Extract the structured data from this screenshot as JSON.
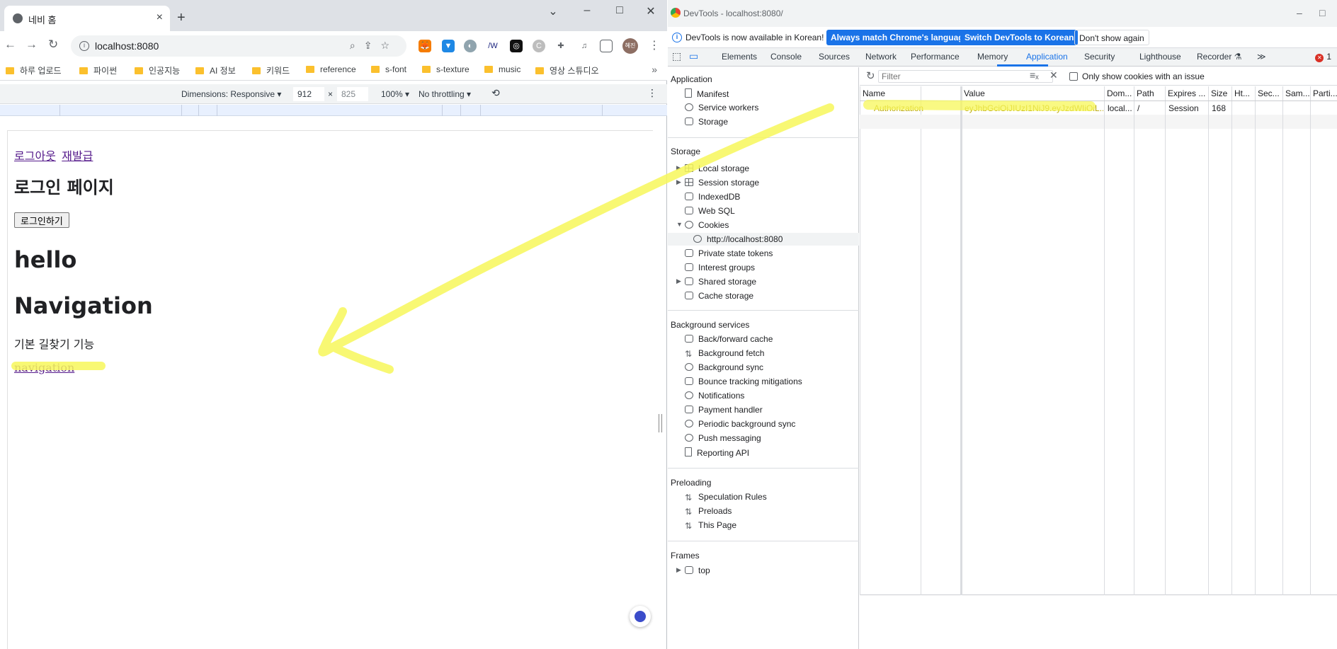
{
  "browser": {
    "tab_title": "네비 홈",
    "url": "localhost:8080",
    "avatar_text": "혜진",
    "bookmarks": [
      "하루 업로드",
      "파이썬",
      "인공지능",
      "AI 정보",
      "키워드",
      "reference",
      "s-font",
      "s-texture",
      "music",
      "영상 스튜디오"
    ],
    "device_toolbar": {
      "dimensions_label": "Dimensions: Responsive ▾",
      "width": "912",
      "height": "825",
      "times": "×",
      "zoom": "100% ▾",
      "throttle": "No throttling ▾"
    }
  },
  "page": {
    "logout_link": "로그아웃",
    "reissue_link": "재발급",
    "heading": "로그인 페이지",
    "login_button": "로그인하기",
    "hello": "hello",
    "navigation_heading": "Navigation",
    "description": "기본 길찾기 기능",
    "navigation_link": "navigation"
  },
  "devtools": {
    "window_title": "DevTools - localhost:8080/",
    "infobar": {
      "message": "DevTools is now available in Korean!",
      "btn_match": "Always match Chrome's language",
      "btn_switch": "Switch DevTools to Korean",
      "btn_dismiss": "Don't show again"
    },
    "tabs": [
      "Elements",
      "Console",
      "Sources",
      "Network",
      "Performance",
      "Memory",
      "Application",
      "Security",
      "Lighthouse",
      "Recorder ⚗"
    ],
    "more_tabs": "≫",
    "active_tab": "Application",
    "error_count": "1",
    "sidebar": {
      "application_title": "Application",
      "application_items": [
        "Manifest",
        "Service workers",
        "Storage"
      ],
      "storage_title": "Storage",
      "storage_items": [
        "Local storage",
        "Session storage",
        "IndexedDB",
        "Web SQL",
        "Cookies",
        "http://localhost:8080",
        "Private state tokens",
        "Interest groups",
        "Shared storage",
        "Cache storage"
      ],
      "background_title": "Background services",
      "background_items": [
        "Back/forward cache",
        "Background fetch",
        "Background sync",
        "Bounce tracking mitigations",
        "Notifications",
        "Payment handler",
        "Periodic background sync",
        "Push messaging",
        "Reporting API"
      ],
      "preloading_title": "Preloading",
      "preloading_items": [
        "Speculation Rules",
        "Preloads",
        "This Page"
      ],
      "frames_title": "Frames",
      "frames_items": [
        "top"
      ]
    },
    "filter_placeholder": "Filter",
    "only_issues_label": "Only show cookies with an issue",
    "columns": [
      "Name",
      "Value",
      "Dom...",
      "Path",
      "Expires ...",
      "Size",
      "Ht...",
      "Sec...",
      "Sam...",
      "Parti..."
    ],
    "cookie": {
      "name": "Authorization",
      "value": "eyJhbGciOiJIUzI1NiJ9.eyJzdWIiOiL...",
      "domain": "local...",
      "path": "/",
      "expires": "Session",
      "size": "168"
    }
  },
  "colors": {
    "highlighter": "#f7f75a",
    "accent": "#1a73e8",
    "link_visited": "#551a8b"
  }
}
